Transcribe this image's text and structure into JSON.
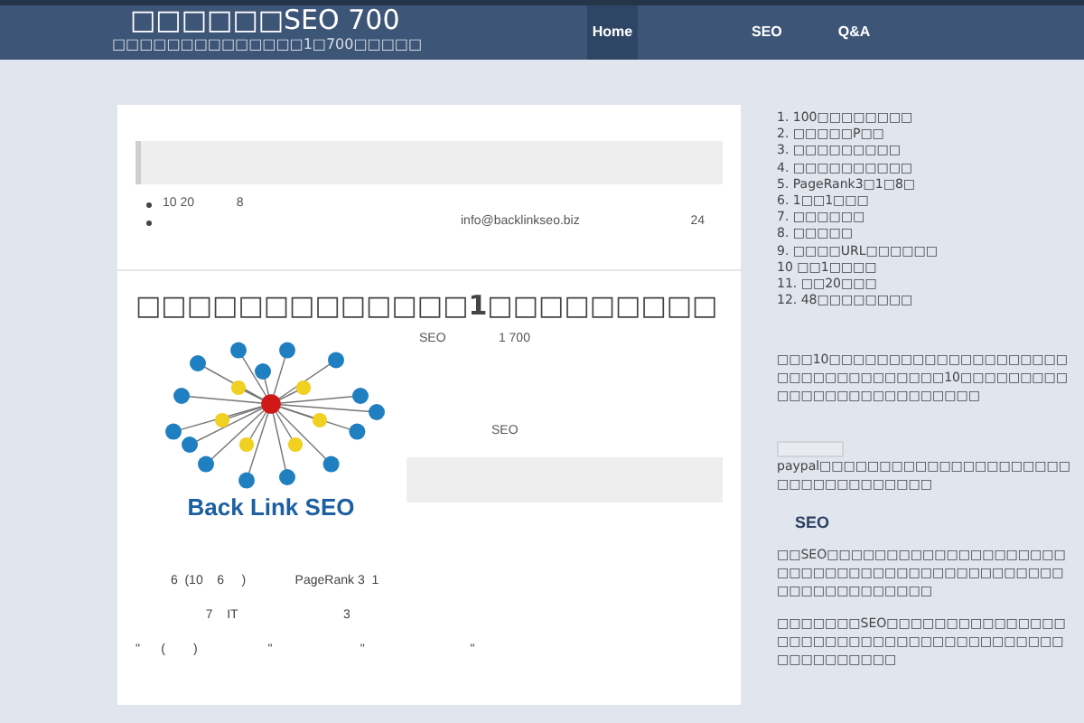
{
  "header": {
    "title": "□□□□□□SEO 700",
    "tagline": "□□□□□□□□□□□□□□1□700□□□□□"
  },
  "nav": [
    {
      "label": "Home",
      "selected": true
    },
    {
      "label": "SEO",
      "selected": false
    },
    {
      "label": "Q&A",
      "selected": false
    }
  ],
  "notice": {
    "items": [
      {
        "text": "10 20            8"
      },
      {
        "extra": "info@backlinkseo.biz",
        "tail": "24"
      }
    ]
  },
  "post": {
    "title": "□□□□□□□□□□□□□1□□□□□□□□□",
    "image_caption": "Back Link SEO",
    "side_lines": [
      "SEO               1 700",
      "SEO"
    ],
    "paragraphs": [
      "          6  (10    6     )              PageRank 3  1",
      "                    7    IT                              3",
      "\"      (        )                    \"                         \"                              \""
    ]
  },
  "sidebar": {
    "list": [
      "1. 100□□□□□□□□",
      "2. □□□□□P□□",
      "3. □□□□□□□□□",
      "4. □□□□□□□□□□",
      "5. PageRank3□1□8□",
      "6. 1□□1□□□",
      "7. □□□□□□",
      "8. □□□□□",
      "9. □□□□URL□□□□□□",
      "10 □□1□□□□",
      "11. □□20□□□",
      "12. 48□□□□□□□□"
    ],
    "intro": "□□□10□□□□□□□□□□□□□□□□□□□□□□□□□□□□□□□□□□10□□□□□□□□□□□□□□□□□□□□□□□□□□",
    "paypal": "paypal□□□□□□□□□□□□□□□□□□□□□□□□□□□□□□□□□□",
    "section_title": "SEO",
    "section_paragraphs": [
      "□□SEO□□□□□□□□□□□□□□□□□□□□□□□□□□□□□□□□□□□□□□□□□□□□□□□□□□□□□□□□□",
      "□□□□□□□SEO□□□□□□□□□□□□□□□□□□□□□□□□□□□□□□□□□□□□□□□□□□□□□□□□□"
    ]
  }
}
